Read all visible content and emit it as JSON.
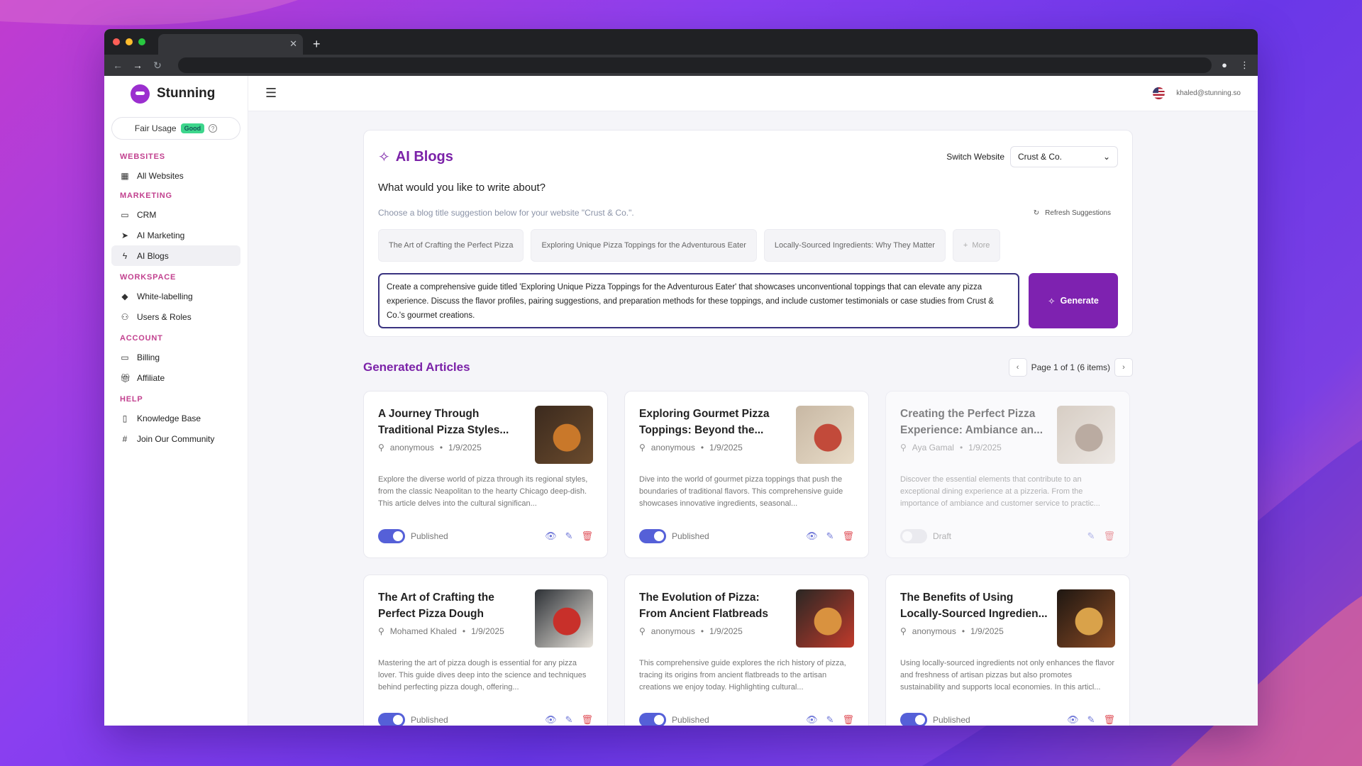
{
  "app": {
    "brand": "Stunning",
    "fair_usage_label": "Fair Usage",
    "fair_usage_badge": "Good",
    "user_email": "khaled@stunning.so"
  },
  "sidebar": {
    "sections": [
      {
        "heading": "WEBSITES",
        "items": [
          {
            "label": "All Websites",
            "icon": "layout-icon"
          }
        ]
      },
      {
        "heading": "MARKETING",
        "items": [
          {
            "label": "CRM",
            "icon": "card-icon"
          },
          {
            "label": "AI Marketing",
            "icon": "send-icon"
          },
          {
            "label": "AI Blogs",
            "icon": "bolt-icon",
            "active": true
          }
        ]
      },
      {
        "heading": "WORKSPACE",
        "items": [
          {
            "label": "White-labelling",
            "icon": "brush-icon"
          },
          {
            "label": "Users & Roles",
            "icon": "users-icon"
          }
        ]
      },
      {
        "heading": "ACCOUNT",
        "items": [
          {
            "label": "Billing",
            "icon": "card-icon"
          },
          {
            "label": "Affiliate",
            "icon": "gift-icon"
          }
        ]
      },
      {
        "heading": "HELP",
        "items": [
          {
            "label": "Knowledge Base",
            "icon": "book-icon"
          },
          {
            "label": "Join Our Community",
            "icon": "slack-icon"
          }
        ]
      }
    ]
  },
  "generator": {
    "title": "AI Blogs",
    "switch_label": "Switch Website",
    "selected_website": "Crust & Co.",
    "question": "What would you like to write about?",
    "hint": "Choose a blog title suggestion below for your website \"Crust & Co.\".",
    "refresh_label": "Refresh Suggestions",
    "suggestions": [
      "The Art of Crafting the Perfect Pizza",
      "Exploring Unique Pizza Toppings for the Adventurous Eater",
      "Locally-Sourced Ingredients: Why They Matter"
    ],
    "more_label": "More",
    "prompt_text": "Create a comprehensive guide titled 'Exploring Unique Pizza Toppings for the Adventurous Eater' that showcases unconventional toppings that can elevate any pizza experience. Discuss the flavor profiles, pairing suggestions, and preparation methods for these toppings, and include customer testimonials or case studies from Crust & Co.'s gourmet creations.",
    "generate_label": "Generate"
  },
  "articles": {
    "heading": "Generated Articles",
    "pager_text": "Page 1 of 1 (6 items)",
    "items": [
      {
        "title": "A Journey Through Traditional Pizza Styles...",
        "author": "anonymous",
        "date": "1/9/2025",
        "excerpt": "Explore the diverse world of pizza through its regional styles, from the classic Neapolitan to the hearty Chicago deep-dish. This article delves into the cultural significan...",
        "status": "Published",
        "published": true,
        "thumb_colors": [
          "#3b2a1e",
          "#c9782a",
          "#6b4b2d"
        ]
      },
      {
        "title": "Exploring Gourmet Pizza Toppings: Beyond the...",
        "author": "anonymous",
        "date": "1/9/2025",
        "excerpt": "Dive into the world of gourmet pizza toppings that push the boundaries of traditional flavors. This comprehensive guide showcases innovative ingredients, seasonal...",
        "status": "Published",
        "published": true,
        "thumb_colors": [
          "#c8b8a4",
          "#c24a3a",
          "#e8dcc8"
        ]
      },
      {
        "title": "Creating the Perfect Pizza Experience: Ambiance an...",
        "author": "Aya Gamal",
        "date": "1/9/2025",
        "excerpt": "Discover the essential elements that contribute to an exceptional dining experience at a pizzeria. From the importance of ambiance and customer service to practic...",
        "status": "Draft",
        "published": false,
        "thumb_colors": [
          "#bfae9a",
          "#8a6f5a",
          "#e6ddd2"
        ]
      },
      {
        "title": "The Art of Crafting the Perfect Pizza Dough",
        "author": "Mohamed Khaled",
        "date": "1/9/2025",
        "excerpt": "Mastering the art of pizza dough is essential for any pizza lover. This guide dives deep into the science and techniques behind perfecting pizza dough, offering...",
        "status": "Published",
        "published": true,
        "thumb_colors": [
          "#2d3136",
          "#c8302a",
          "#e9e4dc"
        ]
      },
      {
        "title": "The Evolution of Pizza: From Ancient Flatbreads to...",
        "author": "anonymous",
        "date": "1/9/2025",
        "excerpt": "This comprehensive guide explores the rich history of pizza, tracing its origins from ancient flatbreads to the artisan creations we enjoy today. Highlighting cultural...",
        "status": "Published",
        "published": true,
        "thumb_colors": [
          "#2a2724",
          "#d9923f",
          "#c03a2b"
        ]
      },
      {
        "title": "The Benefits of Using Locally-Sourced Ingredien...",
        "author": "anonymous",
        "date": "1/9/2025",
        "excerpt": "Using locally-sourced ingredients not only enhances the flavor and freshness of artisan pizzas but also promotes sustainability and supports local economies. In this articl...",
        "status": "Published",
        "published": true,
        "thumb_colors": [
          "#1e1712",
          "#d9a24a",
          "#8a4a24"
        ]
      }
    ]
  },
  "colors": {
    "accent": "#7e22b0",
    "toggle_on": "#5560d8",
    "delete": "#e0535b"
  }
}
